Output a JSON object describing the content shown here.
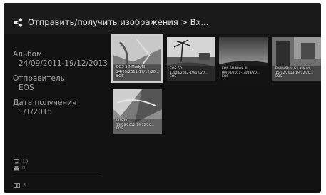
{
  "header": {
    "title": "Отправить/получить изображения > Вх..."
  },
  "sidebar": {
    "album_label": "Альбом",
    "album_value": "24/09/2011-19/12/2013",
    "sender_label": "Отправитель",
    "sender_value": "EOS",
    "date_label": "Дата получения",
    "date_value": "1/1/2015",
    "photos_count": "13",
    "movies_count": "0",
    "albums_count": "5"
  },
  "thumbnails": [
    {
      "camera": "EOS 5D Mark III",
      "dates": "24/09/2011-19/12/20...",
      "sender": "EOS",
      "selected": true
    },
    {
      "camera": "EOS 6D",
      "dates": "13/08/2012-19/12/20...",
      "sender": "EOS",
      "selected": false
    },
    {
      "camera": "EOS 5D Mark III",
      "dates": "09/10/2011-14/08/20...",
      "sender": "EOS",
      "selected": false
    },
    {
      "camera": "PowerShot G1 X Mark...",
      "dates": "15/12/2013-19/12/20...",
      "sender": "EOS",
      "selected": false
    },
    {
      "camera": "EOS 6D",
      "dates": "13/08/2012-19/12/20...",
      "sender": "EOS",
      "selected": false
    }
  ]
}
